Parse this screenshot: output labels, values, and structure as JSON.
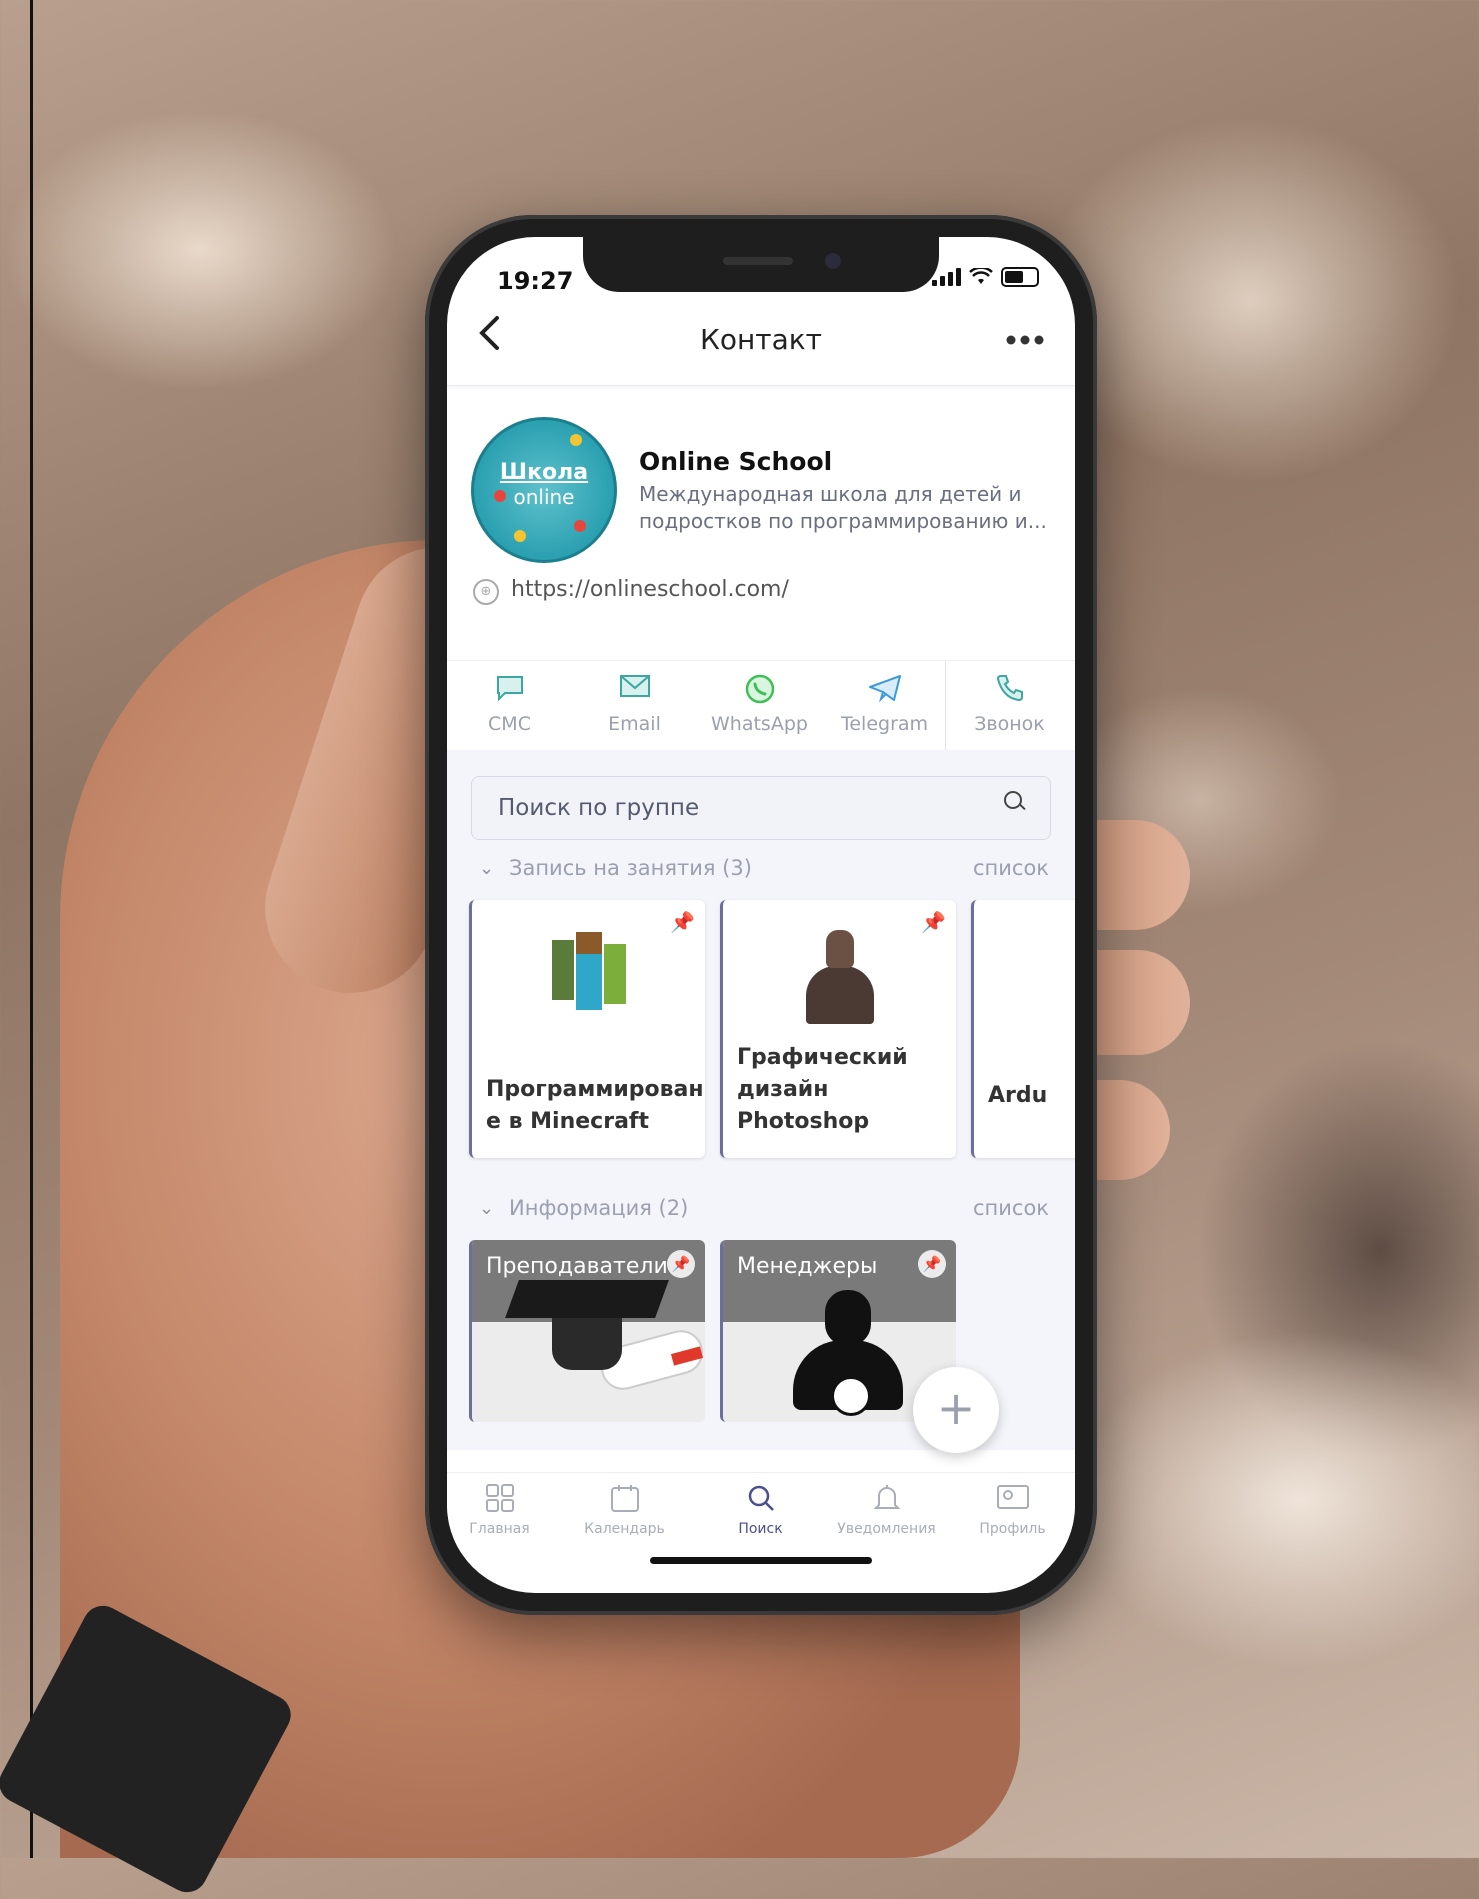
{
  "status": {
    "time": "19:27"
  },
  "nav": {
    "back_icon": "chevron-left-icon",
    "title": "Контакт",
    "more_icon": "more-horizontal-icon"
  },
  "profile": {
    "avatar_line1": "Школа",
    "avatar_line2": "online",
    "name": "Online School",
    "description": "Международная школа для детей и подростков по программированию и...",
    "url": "https://onlineschool.com/"
  },
  "actions": [
    {
      "label": "СМС",
      "icon": "chat-bubble-icon",
      "color": "#3ba7a0"
    },
    {
      "label": "Email",
      "icon": "envelope-icon",
      "color": "#3ba7a0"
    },
    {
      "label": "WhatsApp",
      "icon": "whatsapp-icon",
      "color": "#3fbf56"
    },
    {
      "label": "Telegram",
      "icon": "telegram-icon",
      "color": "#3a9ad9"
    },
    {
      "label": "Звонок",
      "icon": "phone-icon",
      "color": "#3ba7a0"
    }
  ],
  "search": {
    "placeholder": "Поиск по группе"
  },
  "sections": [
    {
      "title": "Запись на занятия (3)",
      "link": "список",
      "cards": [
        {
          "title_line1": "Программировани",
          "title_line2": "е в Minecraft"
        },
        {
          "title_line1": "Графический",
          "title_line2": "дизайн Photoshop"
        },
        {
          "title_line1": "Ardu",
          "title_line2": ""
        }
      ]
    },
    {
      "title": "Информация (2)",
      "link": "список",
      "cards": [
        {
          "title": "Преподаватели"
        },
        {
          "title": "Менеджеры"
        }
      ]
    }
  ],
  "fab": {
    "label": "+"
  },
  "tabbar": [
    {
      "label": "Главная",
      "icon": "grid-icon",
      "active": false
    },
    {
      "label": "Календарь",
      "icon": "calendar-icon",
      "active": false
    },
    {
      "label": "Поиск",
      "icon": "search-icon",
      "active": true
    },
    {
      "label": "Уведомления",
      "icon": "bell-icon",
      "active": false
    },
    {
      "label": "Профиль",
      "icon": "profile-icon",
      "active": false
    }
  ],
  "colors": {
    "accent": "#4b4f8a",
    "card_border": "#6c6f9a",
    "muted": "#9aa0ad"
  }
}
